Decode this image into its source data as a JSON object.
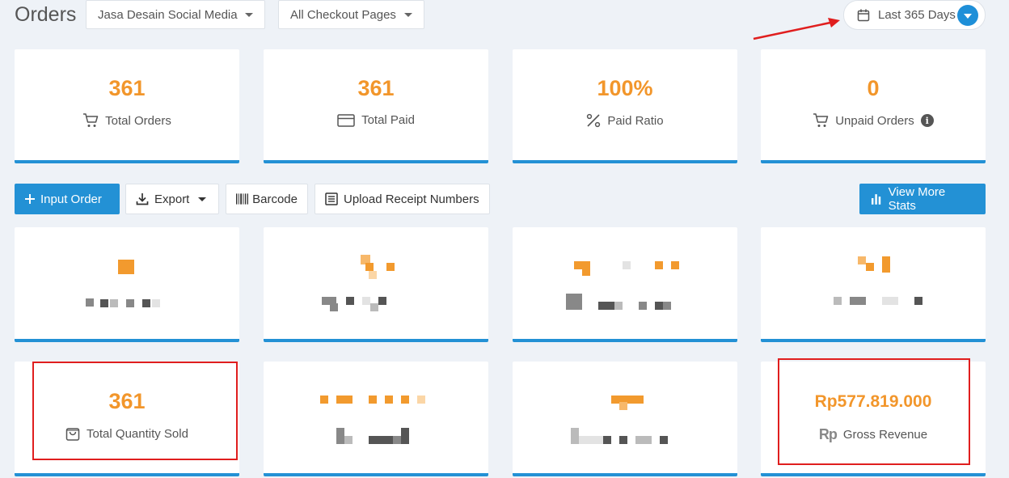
{
  "header": {
    "title": "Orders",
    "product_filter": "Jasa Desain Social Media",
    "checkout_filter": "All Checkout Pages",
    "date_range": "Last 365 Days"
  },
  "stats_top": [
    {
      "value": "361",
      "label": "Total Orders",
      "icon": "cart-icon"
    },
    {
      "value": "361",
      "label": "Total Paid",
      "icon": "credit-card-icon"
    },
    {
      "value": "100%",
      "label": "Paid Ratio",
      "icon": "percent-icon"
    },
    {
      "value": "0",
      "label": "Unpaid Orders",
      "icon": "cart-icon",
      "info": "i"
    }
  ],
  "toolbar": {
    "input_order": "Input Order",
    "export": "Export",
    "barcode": "Barcode",
    "upload_receipt": "Upload Receipt Numbers",
    "view_more_stats": "View More Stats"
  },
  "stats_bottom": [
    {
      "value": "361",
      "label": "Total Quantity Sold",
      "icon": "shopping-bag-icon"
    },
    {
      "value": "Rp577.819.000",
      "label": "Gross Revenue",
      "icon": "rupiah-icon",
      "icon_text": "Rp"
    }
  ],
  "colors": {
    "accent_blue": "#2391d5",
    "value_orange": "#f2962b",
    "annotation_red": "#e01e1e",
    "background": "#eef2f7"
  }
}
